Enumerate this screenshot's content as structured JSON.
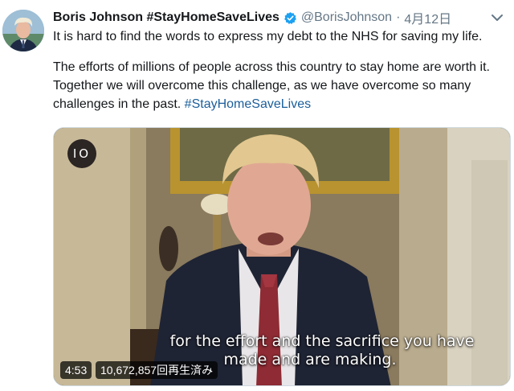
{
  "tweet": {
    "display_name": "Boris Johnson #StayHomeSaveLives",
    "handle": "@BorisJohnson",
    "separator": "·",
    "timestamp": "4月12日",
    "paragraph_1": "It is hard to find the words to express my debt to the NHS for saving my life.",
    "paragraph_2": "The efforts of millions of people across this country to stay home are worth it. Together we will overcome this challenge, as we have overcome so many challenges in the past.",
    "hashtag": "#StayHomeSaveLives"
  },
  "icons": {
    "avatar": "avatar-photo",
    "verified": "verified-badge-icon",
    "menu": "chevron-down-icon"
  },
  "video": {
    "badge": "IO",
    "subtitle_line_1": "for the effort and the sacrifice you have",
    "subtitle_line_2": "made and are making.",
    "duration": "4:53",
    "views": "10,672,857回再生済み"
  },
  "colors": {
    "hashtag": "#1b5e9a",
    "verified": "#1da1f2",
    "secondary_text": "#657786"
  }
}
